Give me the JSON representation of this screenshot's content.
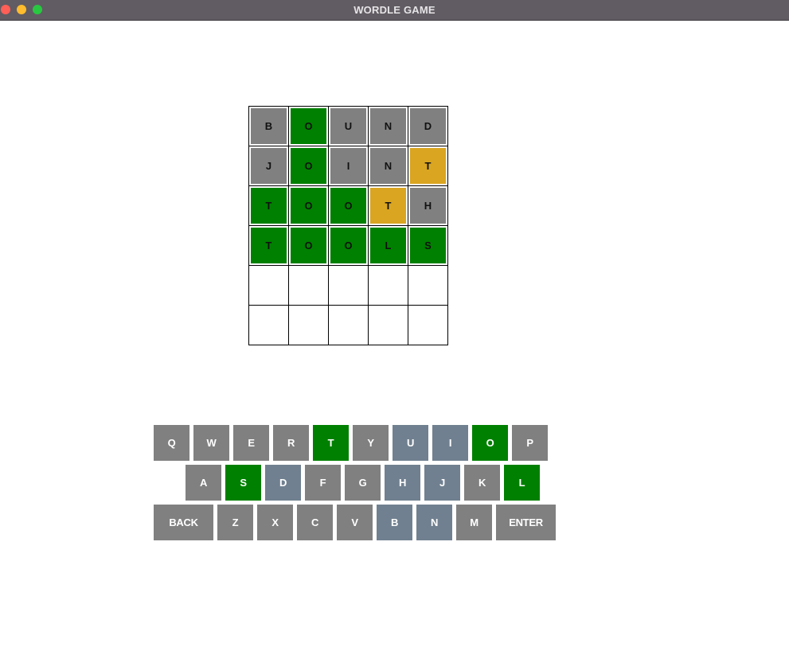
{
  "window": {
    "title": "WORDLE GAME"
  },
  "colors": {
    "correct": "#008000",
    "present": "#daa520",
    "absent": "#808080",
    "unused": "#708090",
    "empty": "#ffffff"
  },
  "board": {
    "rows": [
      [
        {
          "letter": "B",
          "state": "absent"
        },
        {
          "letter": "O",
          "state": "correct"
        },
        {
          "letter": "U",
          "state": "absent"
        },
        {
          "letter": "N",
          "state": "absent"
        },
        {
          "letter": "D",
          "state": "absent"
        }
      ],
      [
        {
          "letter": "J",
          "state": "absent"
        },
        {
          "letter": "O",
          "state": "correct"
        },
        {
          "letter": "I",
          "state": "absent"
        },
        {
          "letter": "N",
          "state": "absent"
        },
        {
          "letter": "T",
          "state": "present"
        }
      ],
      [
        {
          "letter": "T",
          "state": "correct"
        },
        {
          "letter": "O",
          "state": "correct"
        },
        {
          "letter": "O",
          "state": "correct"
        },
        {
          "letter": "T",
          "state": "present"
        },
        {
          "letter": "H",
          "state": "absent"
        }
      ],
      [
        {
          "letter": "T",
          "state": "correct"
        },
        {
          "letter": "O",
          "state": "correct"
        },
        {
          "letter": "O",
          "state": "correct"
        },
        {
          "letter": "L",
          "state": "correct"
        },
        {
          "letter": "S",
          "state": "correct"
        }
      ],
      [
        {
          "letter": "",
          "state": "empty"
        },
        {
          "letter": "",
          "state": "empty"
        },
        {
          "letter": "",
          "state": "empty"
        },
        {
          "letter": "",
          "state": "empty"
        },
        {
          "letter": "",
          "state": "empty"
        }
      ],
      [
        {
          "letter": "",
          "state": "empty"
        },
        {
          "letter": "",
          "state": "empty"
        },
        {
          "letter": "",
          "state": "empty"
        },
        {
          "letter": "",
          "state": "empty"
        },
        {
          "letter": "",
          "state": "empty"
        }
      ]
    ]
  },
  "keyboard": {
    "rows": [
      [
        {
          "label": "Q",
          "state": "absent"
        },
        {
          "label": "W",
          "state": "absent"
        },
        {
          "label": "E",
          "state": "absent"
        },
        {
          "label": "R",
          "state": "absent"
        },
        {
          "label": "T",
          "state": "correct"
        },
        {
          "label": "Y",
          "state": "absent"
        },
        {
          "label": "U",
          "state": "unused"
        },
        {
          "label": "I",
          "state": "unused"
        },
        {
          "label": "O",
          "state": "correct"
        },
        {
          "label": "P",
          "state": "absent"
        }
      ],
      [
        {
          "label": "A",
          "state": "absent"
        },
        {
          "label": "S",
          "state": "correct"
        },
        {
          "label": "D",
          "state": "unused"
        },
        {
          "label": "F",
          "state": "absent"
        },
        {
          "label": "G",
          "state": "absent"
        },
        {
          "label": "H",
          "state": "unused"
        },
        {
          "label": "J",
          "state": "unused"
        },
        {
          "label": "K",
          "state": "absent"
        },
        {
          "label": "L",
          "state": "correct"
        }
      ],
      [
        {
          "label": "BACK",
          "state": "absent",
          "wide": true
        },
        {
          "label": "Z",
          "state": "absent"
        },
        {
          "label": "X",
          "state": "absent"
        },
        {
          "label": "C",
          "state": "absent"
        },
        {
          "label": "V",
          "state": "absent"
        },
        {
          "label": "B",
          "state": "unused"
        },
        {
          "label": "N",
          "state": "unused"
        },
        {
          "label": "M",
          "state": "absent"
        },
        {
          "label": "ENTER",
          "state": "absent",
          "wide": true
        }
      ]
    ]
  }
}
